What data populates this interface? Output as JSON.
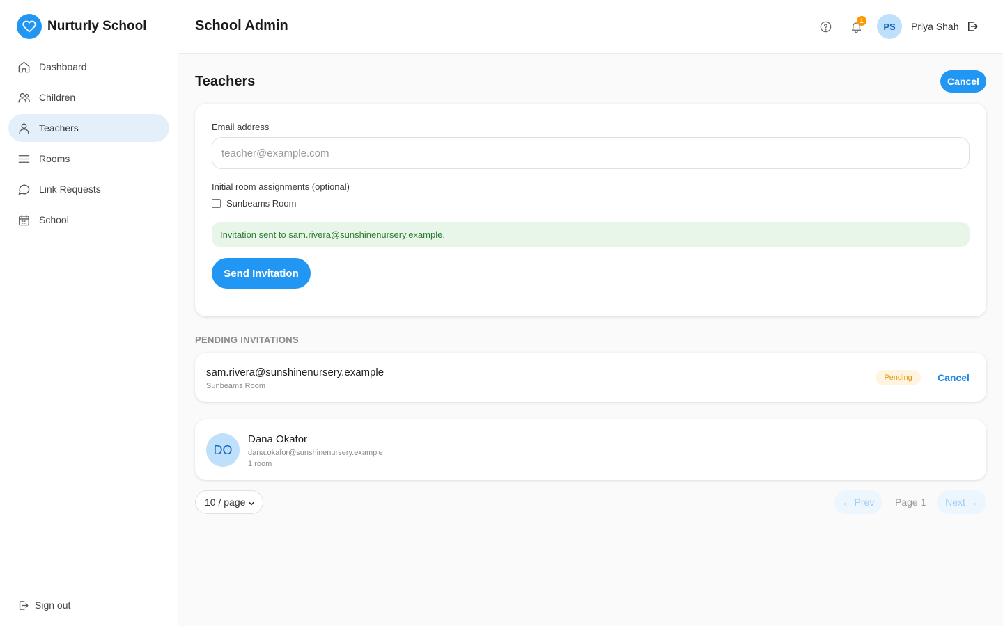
{
  "brand": {
    "name": "Nurturly School",
    "logo_icon": "heart-icon",
    "accent": "#2196f3"
  },
  "sidebar": {
    "items": [
      {
        "label": "Dashboard",
        "icon": "home-icon"
      },
      {
        "label": "Children",
        "icon": "users-icon"
      },
      {
        "label": "Teachers",
        "icon": "user-icon",
        "active": true
      },
      {
        "label": "Rooms",
        "icon": "menu-icon"
      },
      {
        "label": "Link Requests",
        "icon": "chat-bubble-icon"
      },
      {
        "label": "School",
        "icon": "calendar-icon"
      }
    ],
    "sign_out": "Sign out"
  },
  "header": {
    "title": "School Admin",
    "notification_count": "1",
    "user_initials": "PS",
    "user_name": "Priya Shah"
  },
  "page": {
    "title": "Teachers",
    "cancel_label": "Cancel"
  },
  "form": {
    "email_label": "Email address",
    "email_placeholder": "teacher@example.com",
    "email_value": "",
    "rooms_label": "Initial room assignments (optional)",
    "room_option": "Sunbeams Room",
    "room_checked": false,
    "success_message": "Invitation sent to sam.rivera@sunshinenursery.example.",
    "send_label": "Send Invitation"
  },
  "pending": {
    "section_label": "PENDING INVITATIONS",
    "items": [
      {
        "email": "sam.rivera@sunshinenursery.example",
        "room": "Sunbeams Room",
        "status": "Pending",
        "cancel_label": "Cancel"
      }
    ]
  },
  "teachers": {
    "items": [
      {
        "initials": "DO",
        "name": "Dana Okafor",
        "email": "dana.okafor@sunshinenursery.example",
        "rooms": "1 room"
      }
    ]
  },
  "pagination": {
    "page_size": "10 / page",
    "prev_label": "← Prev",
    "page_label": "Page 1",
    "next_label": "Next →"
  }
}
